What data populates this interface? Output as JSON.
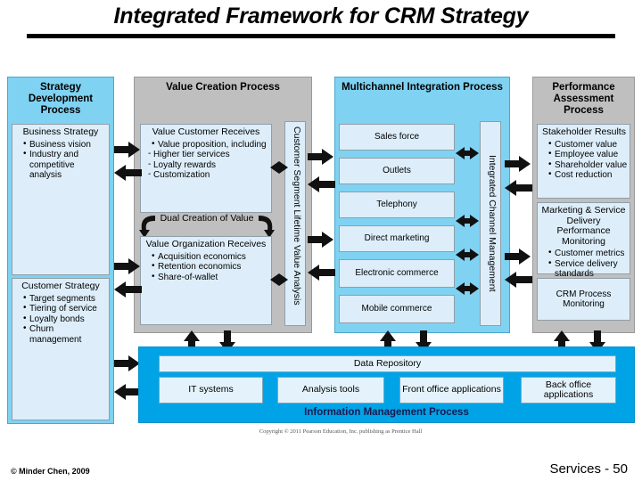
{
  "title": "Integrated Framework for CRM Strategy",
  "columns": {
    "strategy_development": {
      "header": "Strategy Development Process",
      "business_strategy": {
        "heading": "Business Strategy",
        "bullets": [
          "Business vision",
          "Industry and competitive analysis"
        ]
      },
      "customer_strategy": {
        "heading": "Customer Strategy",
        "bullets": [
          "Target segments",
          "Tiering of service",
          "Loyalty bonds",
          "Churn management"
        ]
      }
    },
    "value_creation": {
      "header": "Value Creation Process",
      "value_customer_receives": {
        "heading": "Value Customer Receives",
        "bullets": [
          "Value proposition, including"
        ],
        "sub_bullets": [
          "Higher tier services",
          "Loyalty rewards",
          "Customization"
        ]
      },
      "dual_creation": "Dual Creation of Value",
      "value_organization_receives": {
        "heading": "Value Organization Receives",
        "bullets": [
          "Acquisition economics",
          "Retention economics",
          "Share-of-wallet"
        ]
      },
      "vertical_label": "Customer Segment Lifetime Value Analysis"
    },
    "multichannel": {
      "header": "Multichannel Integration Process",
      "channels": [
        "Sales force",
        "Outlets",
        "Telephony",
        "Direct marketing",
        "Electronic commerce",
        "Mobile commerce"
      ],
      "vertical_label": "Integrated Channel Management"
    },
    "performance": {
      "header": "Performance Assessment Process",
      "stakeholder": {
        "heading": "Stakeholder Results",
        "bullets": [
          "Customer value",
          "Employee value",
          "Shareholder value",
          "Cost reduction"
        ]
      },
      "monitoring": {
        "heading": "Marketing & Service Delivery Performance Monitoring",
        "bullets": [
          "Customer metrics",
          "Service delivery standards"
        ]
      },
      "crm_process": "CRM Process Monitoring"
    }
  },
  "information_management": {
    "data_repository": "Data Repository",
    "items": [
      "IT systems",
      "Analysis tools",
      "Front office applications",
      "Back office applications"
    ],
    "label": "Information Management Process"
  },
  "copyright": "Copyright © 2011 Pearson Education, Inc. publishing as Prentice Hall",
  "footer": {
    "left": "© Minder Chen, 2009",
    "right": "Services - 50"
  },
  "colors": {
    "grey_column": "#bfbfbf",
    "blue_column": "#7fd2f2",
    "inner_box": "#ddeefa",
    "band": "#00a3e6",
    "band_label": "#1a1a4e"
  }
}
